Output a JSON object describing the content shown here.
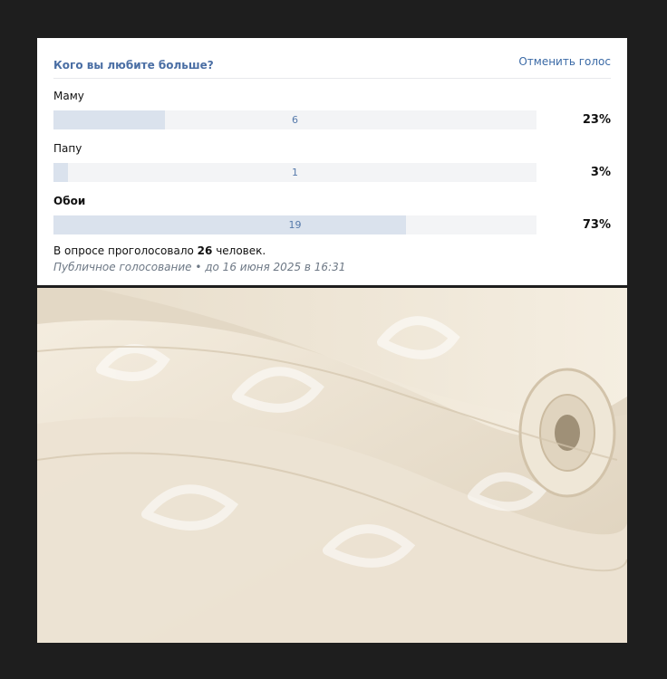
{
  "poll": {
    "question": "Кого вы любите больше?",
    "cancel_label": "Отменить голос",
    "answers": [
      {
        "label": "Маму",
        "count": "6",
        "percent": "23%",
        "fraction": 0.23,
        "selected": false
      },
      {
        "label": "Папу",
        "count": "1",
        "percent": "3%",
        "fraction": 0.03,
        "selected": false
      },
      {
        "label": "Обои",
        "count": "19",
        "percent": "73%",
        "fraction": 0.73,
        "selected": true
      }
    ],
    "summary_prefix": "В опросе проголосовало",
    "summary_count": "26",
    "summary_suffix": "человек.",
    "meta": "Публичное голосование • до 16 июня 2025 в 16:31"
  },
  "colors": {
    "title": "#4a6ea4",
    "bar_track": "#f3f4f6",
    "bar_fill": "#dae2ed",
    "background": "#1e1e1e"
  }
}
